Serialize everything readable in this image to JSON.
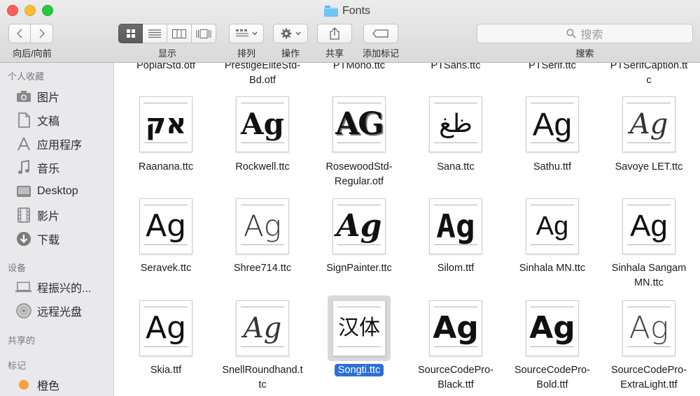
{
  "window": {
    "title": "Fonts"
  },
  "toolbar": {
    "nav_label": "向后/向前",
    "view_label": "显示",
    "arrange_label": "排列",
    "action_label": "操作",
    "share_label": "共享",
    "tag_label": "添加标记",
    "search_label": "搜索",
    "search_placeholder": "搜索"
  },
  "sidebar": {
    "favorites_header": "个人收藏",
    "favorites": [
      {
        "label": "图片",
        "icon": "camera-icon"
      },
      {
        "label": "文稿",
        "icon": "document-icon"
      },
      {
        "label": "应用程序",
        "icon": "apps-icon"
      },
      {
        "label": "音乐",
        "icon": "music-icon"
      },
      {
        "label": "Desktop",
        "icon": "desktop-icon"
      },
      {
        "label": "影片",
        "icon": "film-icon"
      },
      {
        "label": "下载",
        "icon": "download-icon"
      }
    ],
    "devices_header": "设备",
    "devices": [
      {
        "label": "程振兴的...",
        "icon": "laptop-icon"
      },
      {
        "label": "远程光盘",
        "icon": "disc-icon"
      }
    ],
    "shared_header": "共享的",
    "tags_header": "标记",
    "tags": [
      {
        "label": "橙色",
        "color": "#f5a142"
      }
    ]
  },
  "files": {
    "row0": [
      {
        "l1": "PoplarStd.otf",
        "l2": ""
      },
      {
        "l1": "PrestigeEliteStd-",
        "l2": "Bd.otf"
      },
      {
        "l1": "PTMono.ttc",
        "l2": ""
      },
      {
        "l1": "PTSans.ttc",
        "l2": ""
      },
      {
        "l1": "PTSerif.ttc",
        "l2": ""
      },
      {
        "l1": "PTSerifCaption.tt",
        "l2": "c"
      }
    ],
    "row1": [
      {
        "l1": "Raanana.ttc",
        "l2": "",
        "glyph": "אק"
      },
      {
        "l1": "Rockwell.ttc",
        "l2": "",
        "glyph": "Ag"
      },
      {
        "l1": "RosewoodStd-",
        "l2": "Regular.otf",
        "glyph": "AG"
      },
      {
        "l1": "Sana.ttc",
        "l2": "",
        "glyph": "ظغ"
      },
      {
        "l1": "Sathu.ttf",
        "l2": "",
        "glyph": "Ag"
      },
      {
        "l1": "Savoye LET.ttc",
        "l2": "",
        "glyph": "Ag"
      }
    ],
    "row2": [
      {
        "l1": "Seravek.ttc",
        "l2": "",
        "glyph": "Ag"
      },
      {
        "l1": "Shree714.ttc",
        "l2": "",
        "glyph": "Ag"
      },
      {
        "l1": "SignPainter.ttc",
        "l2": "",
        "glyph": "Ag"
      },
      {
        "l1": "Silom.ttf",
        "l2": "",
        "glyph": "Ag"
      },
      {
        "l1": "Sinhala MN.ttc",
        "l2": "",
        "glyph": "Ag"
      },
      {
        "l1": "Sinhala Sangam",
        "l2": "MN.ttc",
        "glyph": "Ag"
      }
    ],
    "row3": [
      {
        "l1": "Skia.ttf",
        "l2": "",
        "glyph": "Ag"
      },
      {
        "l1": "SnellRoundhand.t",
        "l2": "tc",
        "glyph": "Ag"
      },
      {
        "l1": "Songti.ttc",
        "l2": "",
        "glyph": "汉体",
        "selected": true
      },
      {
        "l1": "SourceCodePro-",
        "l2": "Black.ttf",
        "glyph": "Ag"
      },
      {
        "l1": "SourceCodePro-",
        "l2": "Bold.ttf",
        "glyph": "Ag"
      },
      {
        "l1": "SourceCodePro-",
        "l2": "ExtraLight.ttf",
        "glyph": "Ag"
      }
    ]
  }
}
